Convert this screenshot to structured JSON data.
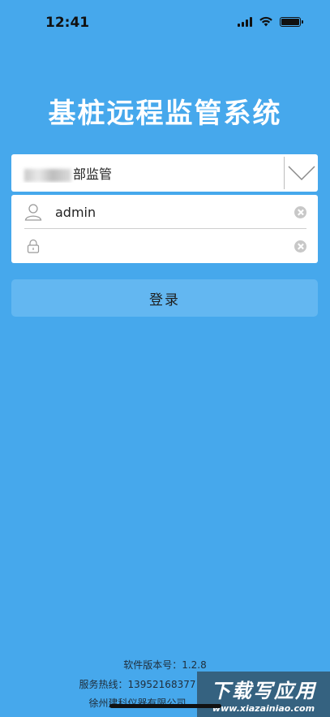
{
  "status_bar": {
    "time": "12:41"
  },
  "app": {
    "title": "基桩远程监管系统"
  },
  "unit_select": {
    "value_suffix": "部监管"
  },
  "login": {
    "username_value": "admin",
    "password_value": "",
    "submit_label": "登录"
  },
  "footer": {
    "version": "软件版本号：1.2.8",
    "hotline": "服务热线：13952168377",
    "company": "徐州建科仪器有限公司"
  },
  "watermark": {
    "main": "下载写应用",
    "sub": "www.xiazainiao.com"
  },
  "colors": {
    "background": "#46a8ec",
    "button": "#63b7f1",
    "card": "#ffffff"
  },
  "icons": {
    "user": "user-icon",
    "lock": "lock-icon",
    "clear": "clear-icon",
    "dropdown": "chevron-down-icon"
  }
}
